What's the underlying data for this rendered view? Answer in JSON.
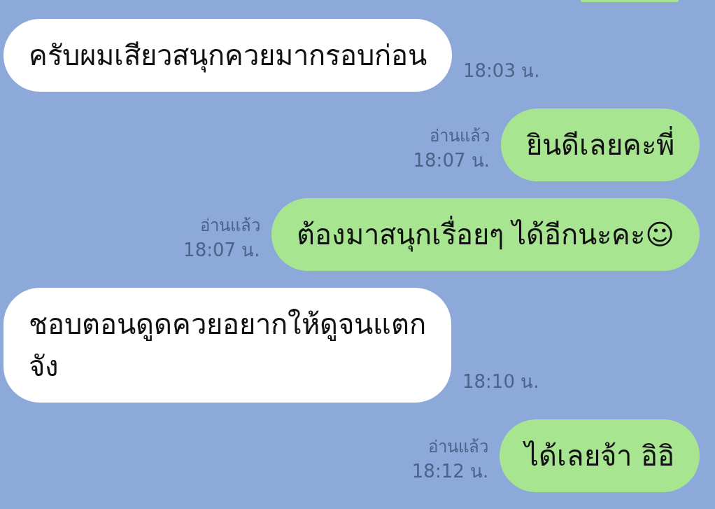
{
  "messages": [
    {
      "kind": "incoming",
      "text": "ครับผมเสียวสนุกควยมากรอบก่อน",
      "time": "18:03 น."
    },
    {
      "kind": "outgoing",
      "text": "ยินดีเลยคะพี่",
      "read": "อ่านแล้ว",
      "time": "18:07 น."
    },
    {
      "kind": "outgoing",
      "text": "ต้องมาสนุกเรื่อยๆ ได้อีกนะคะ☺",
      "read": "อ่านแล้ว",
      "time": "18:07 น."
    },
    {
      "kind": "incoming",
      "text": "ชอบตอนดูดควยอยากให้ดูจนแตก\nจัง",
      "time": "18:10 น."
    },
    {
      "kind": "outgoing",
      "text": "ได้เลยจ้า อิอิ",
      "read": "อ่านแล้ว",
      "time": "18:12 น."
    }
  ]
}
